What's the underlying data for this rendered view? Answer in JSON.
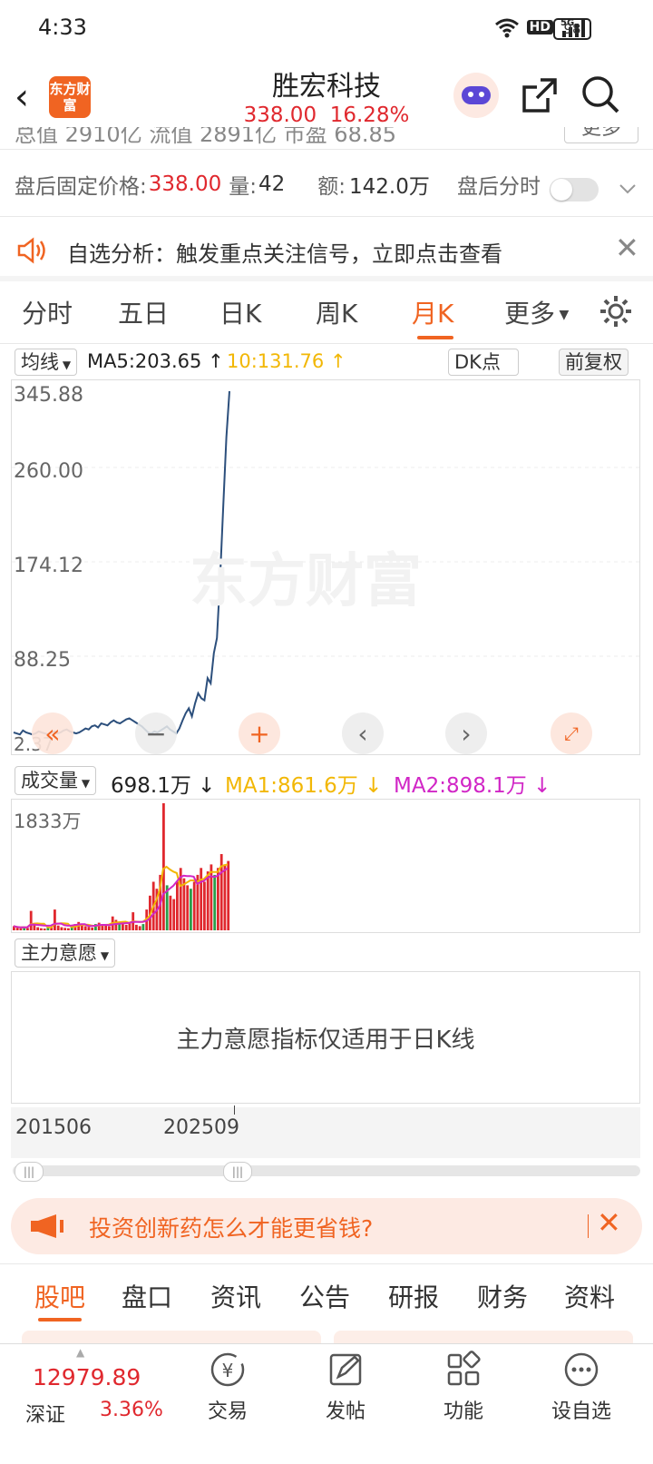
{
  "status_bar": {
    "time": "4:33",
    "battery": "98"
  },
  "header": {
    "logo_text": "东方财富",
    "title": "胜宏科技",
    "price": "338.00",
    "change_pct": "16.28%"
  },
  "stats_partial": {
    "text": "总值 2910亿  流值 2891亿  市盈 68.85",
    "more": "更多"
  },
  "after_hours": {
    "label": "盘后固定价格:",
    "price": "338.00",
    "vol_label": "量:",
    "vol": "42",
    "amt_label": "额:",
    "amt": "142.0万",
    "toggle_label": "盘后分时"
  },
  "notice": {
    "text": "自选分析：触发重点关注信号，立即点击查看"
  },
  "period_tabs": [
    "分时",
    "五日",
    "日K",
    "周K",
    "月K",
    "更多"
  ],
  "active_tab": "月K",
  "indicator_bar": {
    "ma_select": "均线",
    "ma5": "MA5:203.65",
    "ma10": "10:131.76",
    "dk": "DK点",
    "adjust": "前复权"
  },
  "price_axis": [
    "345.88",
    "260.00",
    "174.12",
    "88.25",
    "2.37"
  ],
  "volume_bar": {
    "select": "成交量",
    "vol": "698.1万",
    "ma1": "MA1:861.6万",
    "ma2": "MA2:898.1万",
    "max": "1833万"
  },
  "zhuli": {
    "select": "主力意愿",
    "message": "主力意愿指标仅适用于日K线"
  },
  "date_axis": [
    "201506",
    "202509"
  ],
  "ad": {
    "text": "投资创新药怎么才能更省钱?"
  },
  "bottom_tabs": [
    "股吧",
    "盘口",
    "资讯",
    "公告",
    "研报",
    "财务",
    "资料"
  ],
  "dock": {
    "index_value": "12979.89",
    "index_name": "深证",
    "index_change": "3.36%",
    "items": [
      "交易",
      "发帖",
      "功能",
      "设自选"
    ]
  },
  "watermark": "东方财富",
  "colors": {
    "accent": "#f06422",
    "up": "#e0282e",
    "line": "#2c4f7c",
    "ma1": "#f2b705",
    "ma2": "#d126c6"
  },
  "chart_data": {
    "type": "line",
    "ylim": [
      2.37,
      345.88
    ],
    "price_series": [
      6,
      5,
      4,
      8,
      6,
      5,
      4,
      5,
      7,
      6,
      5,
      4,
      6,
      7,
      5,
      6,
      8,
      9,
      7,
      6,
      5,
      6,
      8,
      10,
      9,
      12,
      13,
      11,
      15,
      14,
      13,
      16,
      18,
      16,
      15,
      17,
      19,
      20,
      18,
      16,
      14,
      12,
      9,
      6,
      5,
      7,
      6,
      8,
      10,
      12,
      9,
      7,
      5,
      10,
      18,
      25,
      30,
      22,
      35,
      45,
      40,
      38,
      60,
      55,
      85,
      100,
      160,
      230,
      300,
      345.88
    ],
    "volume_series": [
      60,
      40,
      30,
      50,
      35,
      280,
      90,
      45,
      30,
      25,
      40,
      50,
      300,
      70,
      45,
      35,
      30,
      60,
      90,
      120,
      80,
      60,
      50,
      40,
      90,
      110,
      80,
      70,
      60,
      200,
      150,
      100,
      90,
      80,
      120,
      260,
      80,
      60,
      90,
      300,
      500,
      700,
      600,
      800,
      1833,
      650,
      500,
      450,
      700,
      900,
      750,
      650,
      600,
      700,
      800,
      900,
      700,
      850,
      950,
      800,
      900,
      1100,
      950,
      1000
    ]
  }
}
